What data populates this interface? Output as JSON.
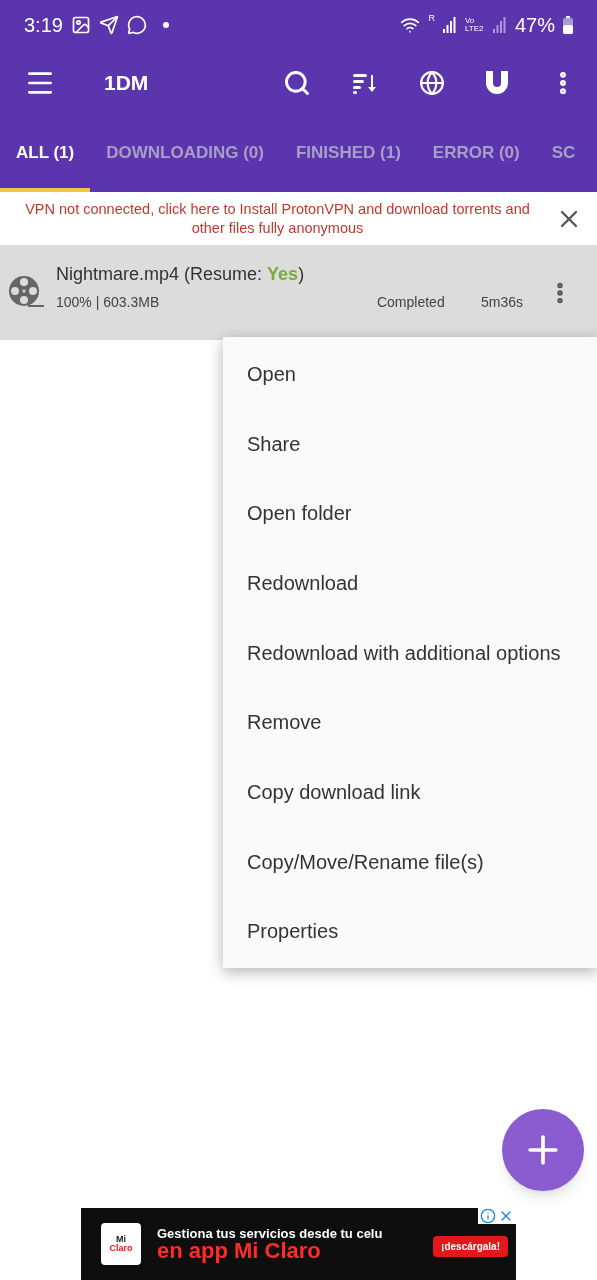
{
  "status_bar": {
    "time": "3:19",
    "network_labels": [
      "R",
      "Vo LTE2"
    ],
    "battery": "47%"
  },
  "toolbar": {
    "title": "1DM"
  },
  "tabs": [
    {
      "label": "ALL (1)",
      "selected": true
    },
    {
      "label": "DOWNLOADING (0)",
      "selected": false
    },
    {
      "label": "FINISHED (1)",
      "selected": false
    },
    {
      "label": "ERROR (0)",
      "selected": false
    },
    {
      "label": "SC",
      "selected": false
    }
  ],
  "vpn_notice": "VPN not connected, click here to Install ProtonVPN and download torrents and other files fully anonymous",
  "downloads": [
    {
      "name": "Nightmare.mp4 (Resume: ",
      "resume": "Yes",
      "name_end": ")",
      "progress": "100% | 603.3MB",
      "status": "Completed",
      "duration": "5m36s"
    }
  ],
  "context_menu": [
    "Open",
    "Share",
    "Open folder",
    "Redownload",
    "Redownload with additional options",
    "Remove",
    "Copy download link",
    "Copy/Move/Rename file(s)",
    "Properties"
  ],
  "ad": {
    "logo_top": "Mi",
    "logo_bottom": "Claro",
    "headline": "Gestiona tus servicios desde tu celu",
    "subheadline": "en app Mi Claro",
    "cta": "¡descárgala!"
  }
}
